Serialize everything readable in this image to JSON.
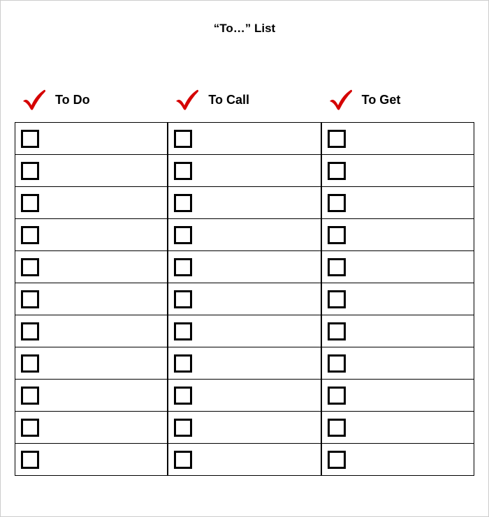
{
  "title": "“To…” List",
  "columns": [
    {
      "label": "To Do"
    },
    {
      "label": "To Call"
    },
    {
      "label": "To Get"
    }
  ],
  "rowCount": 11
}
